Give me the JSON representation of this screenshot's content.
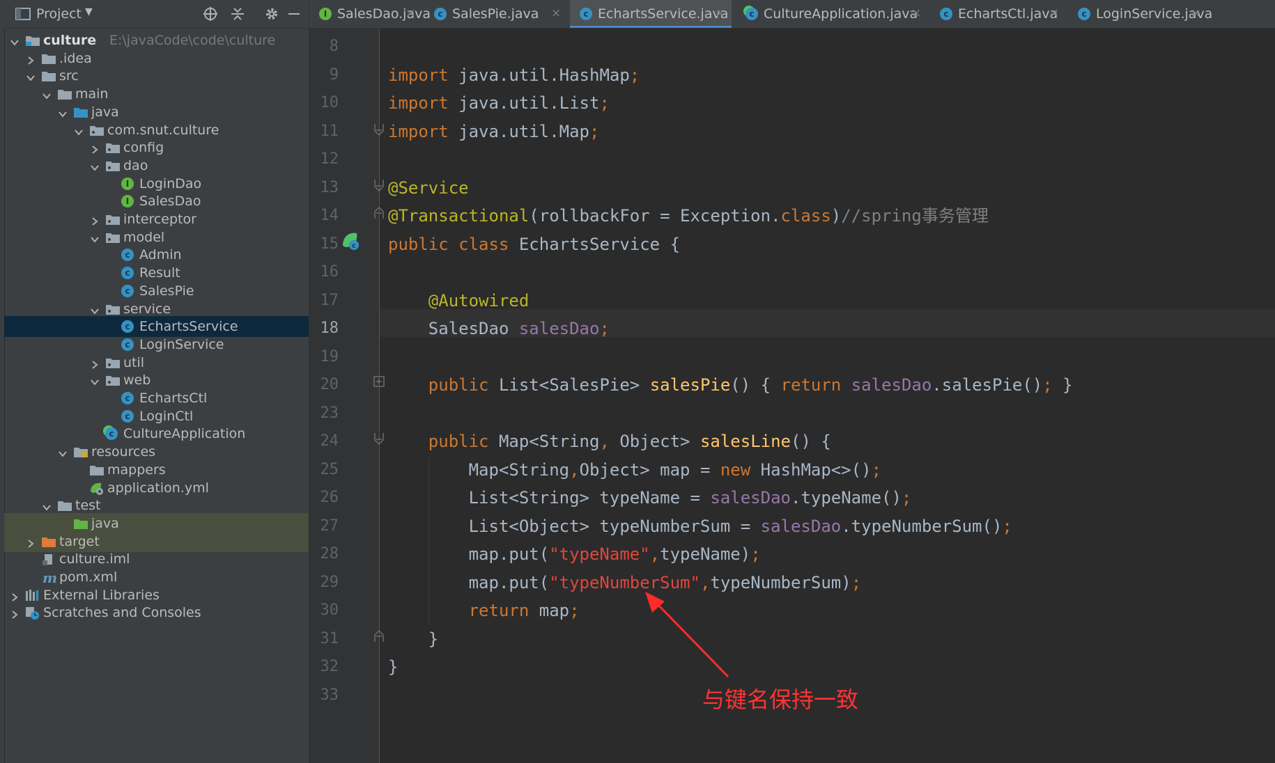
{
  "project_panel": {
    "title": "Project",
    "tree": [
      {
        "label": "culture",
        "path": "E:\\javaCode\\code\\culture",
        "icon": "module-folder-icon",
        "depth": 0,
        "expanded": true
      },
      {
        "label": ".idea",
        "icon": "folder-icon",
        "depth": 1,
        "expanded": false
      },
      {
        "label": "src",
        "icon": "folder-icon",
        "depth": 1,
        "expanded": true
      },
      {
        "label": "main",
        "icon": "folder-icon",
        "depth": 2,
        "expanded": true
      },
      {
        "label": "java",
        "icon": "source-folder-icon",
        "depth": 3,
        "expanded": true
      },
      {
        "label": "com.snut.culture",
        "icon": "package-icon",
        "depth": 4,
        "expanded": true
      },
      {
        "label": "config",
        "icon": "package-icon",
        "depth": 5,
        "expanded": false
      },
      {
        "label": "dao",
        "icon": "package-icon",
        "depth": 5,
        "expanded": true
      },
      {
        "label": "LoginDao",
        "icon": "interface-icon",
        "depth": 6
      },
      {
        "label": "SalesDao",
        "icon": "interface-icon",
        "depth": 6
      },
      {
        "label": "interceptor",
        "icon": "package-icon",
        "depth": 5,
        "expanded": false
      },
      {
        "label": "model",
        "icon": "package-icon",
        "depth": 5,
        "expanded": true
      },
      {
        "label": "Admin",
        "icon": "class-icon",
        "depth": 6
      },
      {
        "label": "Result",
        "icon": "class-icon",
        "depth": 6
      },
      {
        "label": "SalesPie",
        "icon": "class-icon",
        "depth": 6
      },
      {
        "label": "service",
        "icon": "package-icon",
        "depth": 5,
        "expanded": true
      },
      {
        "label": "EchartsService",
        "icon": "class-icon",
        "depth": 6,
        "selected": true
      },
      {
        "label": "LoginService",
        "icon": "class-icon",
        "depth": 6
      },
      {
        "label": "util",
        "icon": "package-icon",
        "depth": 5,
        "expanded": false
      },
      {
        "label": "web",
        "icon": "package-icon",
        "depth": 5,
        "expanded": true
      },
      {
        "label": "EchartsCtl",
        "icon": "class-icon",
        "depth": 6
      },
      {
        "label": "LoginCtl",
        "icon": "class-icon",
        "depth": 6
      },
      {
        "label": "CultureApplication",
        "icon": "spring-boot-class-icon",
        "depth": 5
      },
      {
        "label": "resources",
        "icon": "resources-folder-icon",
        "depth": 3,
        "expanded": true
      },
      {
        "label": "mappers",
        "icon": "folder-icon",
        "depth": 4
      },
      {
        "label": "application.yml",
        "icon": "yaml-config-icon",
        "depth": 4
      },
      {
        "label": "test",
        "icon": "folder-icon",
        "depth": 2,
        "expanded": true
      },
      {
        "label": "java",
        "icon": "test-source-folder-icon",
        "depth": 3
      },
      {
        "label": "target",
        "icon": "excluded-folder-icon",
        "depth": 1,
        "expanded": false
      },
      {
        "label": "culture.iml",
        "icon": "iml-file-icon",
        "depth": 1
      },
      {
        "label": "pom.xml",
        "icon": "maven-icon",
        "depth": 1
      },
      {
        "label": "External Libraries",
        "icon": "libraries-icon",
        "depth": 0,
        "expanded": false
      },
      {
        "label": "Scratches and Consoles",
        "icon": "scratches-icon",
        "depth": 0,
        "expanded": false
      }
    ]
  },
  "tabs": [
    {
      "label": "SalesDao.java",
      "icon": "interface-icon"
    },
    {
      "label": "SalesPie.java",
      "icon": "class-icon"
    },
    {
      "label": "EchartsService.java",
      "icon": "class-icon",
      "active": true
    },
    {
      "label": "CultureApplication.java",
      "icon": "spring-boot-class-icon"
    },
    {
      "label": "EchartsCtl.java",
      "icon": "class-icon"
    },
    {
      "label": "LoginService.java",
      "icon": "class-icon"
    }
  ],
  "editor": {
    "current_line": "18",
    "lines": [
      {
        "n": "8",
        "tokens": []
      },
      {
        "n": "9",
        "tokens": [
          [
            "kw",
            "import "
          ],
          [
            "",
            "java.util.HashMap"
          ],
          [
            "kw",
            ";"
          ]
        ]
      },
      {
        "n": "10",
        "tokens": [
          [
            "kw",
            "import "
          ],
          [
            "",
            "java.util.List"
          ],
          [
            "kw",
            ";"
          ]
        ]
      },
      {
        "n": "11",
        "tokens": [
          [
            "kw",
            "import "
          ],
          [
            "",
            "java.util.Map"
          ],
          [
            "kw",
            ";"
          ]
        ]
      },
      {
        "n": "12",
        "tokens": []
      },
      {
        "n": "13",
        "tokens": [
          [
            "ann",
            "@Service"
          ]
        ]
      },
      {
        "n": "14",
        "tokens": [
          [
            "ann",
            "@Transactional"
          ],
          [
            "",
            "(rollbackFor = Exception."
          ],
          [
            "kw",
            "class"
          ],
          [
            "",
            ")"
          ],
          [
            "cmt",
            "//spring事务管理"
          ]
        ]
      },
      {
        "n": "15",
        "tokens": [
          [
            "kw",
            "public class "
          ],
          [
            "",
            "EchartsService {"
          ]
        ]
      },
      {
        "n": "16",
        "tokens": []
      },
      {
        "n": "17",
        "tokens": [
          [
            "",
            "    "
          ],
          [
            "ann",
            "@Autowired"
          ]
        ]
      },
      {
        "n": "18",
        "tokens": [
          [
            "",
            "    SalesDao "
          ],
          [
            "fld",
            "salesDao"
          ],
          [
            "kw",
            ";"
          ]
        ]
      },
      {
        "n": "19",
        "tokens": []
      },
      {
        "n": "20",
        "tokens": [
          [
            "",
            "    "
          ],
          [
            "kw",
            "public "
          ],
          [
            "",
            "List<SalesPie> "
          ],
          [
            "fn",
            "salesPie"
          ],
          [
            "",
            "() { "
          ],
          [
            "kw",
            "return "
          ],
          [
            "fld",
            "salesDao"
          ],
          [
            "",
            ".salesPie()"
          ],
          [
            "kw",
            ";"
          ],
          [
            "",
            " }"
          ]
        ]
      },
      {
        "n": "23",
        "tokens": []
      },
      {
        "n": "24",
        "tokens": [
          [
            "",
            "    "
          ],
          [
            "kw",
            "public "
          ],
          [
            "",
            "Map<String"
          ],
          [
            "kw",
            ", "
          ],
          [
            "",
            "Object> "
          ],
          [
            "fn",
            "salesLine"
          ],
          [
            "",
            "() {"
          ]
        ]
      },
      {
        "n": "25",
        "tokens": [
          [
            "",
            "        Map<String"
          ],
          [
            "kw",
            ","
          ],
          [
            "",
            "Object> map = "
          ],
          [
            "kw",
            "new "
          ],
          [
            "",
            "HashMap<>()"
          ],
          [
            "kw",
            ";"
          ]
        ]
      },
      {
        "n": "26",
        "tokens": [
          [
            "",
            "        List<String> typeName = "
          ],
          [
            "fld",
            "salesDao"
          ],
          [
            "",
            ".typeName()"
          ],
          [
            "kw",
            ";"
          ]
        ]
      },
      {
        "n": "27",
        "tokens": [
          [
            "",
            "        List<Object> typeNumberSum = "
          ],
          [
            "fld",
            "salesDao"
          ],
          [
            "",
            ".typeNumberSum()"
          ],
          [
            "kw",
            ";"
          ]
        ]
      },
      {
        "n": "28",
        "tokens": [
          [
            "",
            "        map.put("
          ],
          [
            "strr",
            "\"typeName\""
          ],
          [
            "kw",
            ","
          ],
          [
            "",
            "typeName)"
          ],
          [
            "kw",
            ";"
          ]
        ]
      },
      {
        "n": "29",
        "tokens": [
          [
            "",
            "        map.put("
          ],
          [
            "strr",
            "\"typeNumberSum\""
          ],
          [
            "kw",
            ","
          ],
          [
            "",
            "typeNumberSum)"
          ],
          [
            "kw",
            ";"
          ]
        ]
      },
      {
        "n": "30",
        "tokens": [
          [
            "",
            "        "
          ],
          [
            "kw",
            "return "
          ],
          [
            "",
            "map"
          ],
          [
            "kw",
            ";"
          ]
        ]
      },
      {
        "n": "31",
        "tokens": [
          [
            "",
            "    }"
          ]
        ]
      },
      {
        "n": "32",
        "tokens": [
          [
            "",
            "}"
          ]
        ]
      },
      {
        "n": "33",
        "tokens": []
      }
    ]
  },
  "annotation": {
    "text": "与键名保持一致",
    "color": "#ff3333"
  }
}
